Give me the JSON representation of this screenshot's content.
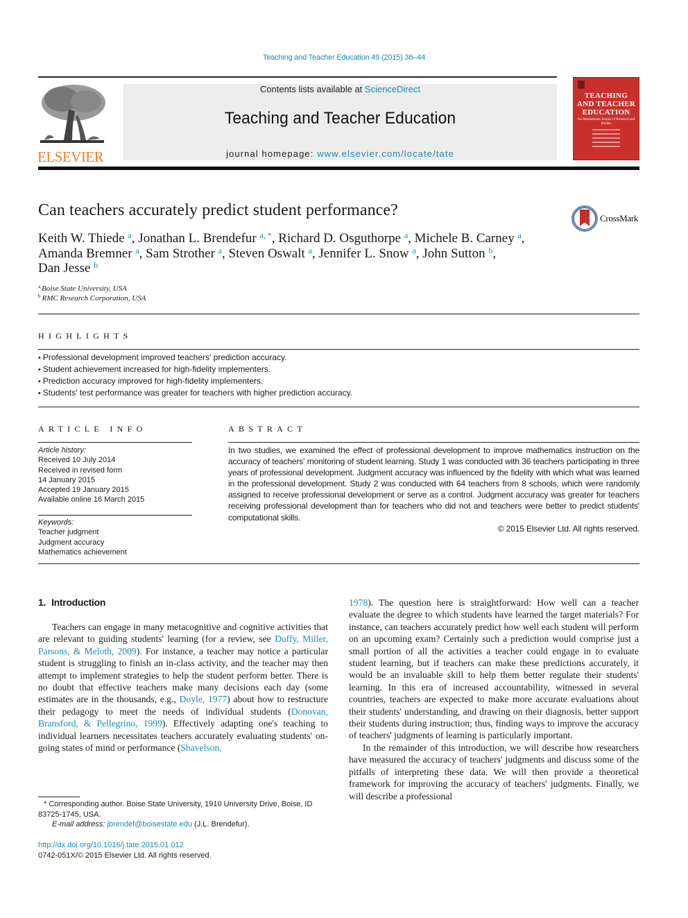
{
  "header": {
    "citation": "Teaching and Teacher Education 49 (2015) 36–44",
    "contents_prefix": "Contents lists available at ",
    "contents_link": "ScienceDirect",
    "journal_title": "Teaching and Teacher Education",
    "homepage_prefix": "journal homepage: ",
    "homepage_link": "www.elsevier.com/locate/tate",
    "publisher_logo_text": "ELSEVIER",
    "cover": {
      "line1": "TEACHING",
      "line2": "AND TEACHER",
      "line3": "EDUCATION",
      "subtitle": "An International Journal of Research and Studies",
      "color": "#c9302c"
    }
  },
  "article": {
    "title": "Can teachers accurately predict student performance?",
    "crossmark_label": "CrossMark",
    "authors": [
      {
        "name": "Keith W. Thiede",
        "aff": "a"
      },
      {
        "name": "Jonathan L. Brendefur",
        "aff": "a, *"
      },
      {
        "name": "Richard D. Osguthorpe",
        "aff": "a"
      },
      {
        "name": "Michele B. Carney",
        "aff": "a"
      },
      {
        "name": "Amanda Bremner",
        "aff": "a"
      },
      {
        "name": "Sam Strother",
        "aff": "a"
      },
      {
        "name": "Steven Oswalt",
        "aff": "a"
      },
      {
        "name": "Jennifer L. Snow",
        "aff": "a"
      },
      {
        "name": "John Sutton",
        "aff": "b"
      },
      {
        "name": "Dan Jesse",
        "aff": "b"
      }
    ],
    "affiliations": [
      {
        "key": "a",
        "text": "Boise State University, USA"
      },
      {
        "key": "b",
        "text": "RMC Research Corporation, USA"
      }
    ]
  },
  "highlights": {
    "heading": "HIGHLIGHTS",
    "items": [
      "Professional development improved teachers' prediction accuracy.",
      "Student achievement increased for high-fidelity implementers.",
      "Prediction accuracy improved for high-fidelity implementers.",
      "Students' test performance was greater for teachers with higher prediction accuracy."
    ]
  },
  "article_info": {
    "heading": "ARTICLE INFO",
    "history_label": "Article history:",
    "history": [
      "Received 10 July 2014",
      "Received in revised form",
      "14 January 2015",
      "Accepted 19 January 2015",
      "Available online 16 March 2015"
    ],
    "keywords_label": "Keywords:",
    "keywords": [
      "Teacher judgment",
      "Judgment accuracy",
      "Mathematics achievement"
    ]
  },
  "abstract": {
    "heading": "ABSTRACT",
    "text": "In two studies, we examined the effect of professional development to improve mathematics instruction on the accuracy of teachers' monitoring of student learning. Study 1 was conducted with 36 teachers participating in three years of professional development. Judgment accuracy was influenced by the fidelity with which what was learned in the professional development. Study 2 was conducted with 64 teachers from 8 schools, which were randomly assigned to receive professional development or serve as a control. Judgment accuracy was greater for teachers receiving professional development than for teachers who did not and teachers were better to predict students' computational skills.",
    "copyright": "© 2015 Elsevier Ltd. All rights reserved."
  },
  "intro": {
    "number": "1.",
    "heading": "Introduction",
    "p1_a": "Teachers can engage in many metacognitive and cognitive activities that are relevant to guiding students' learning (for a review, see ",
    "p1_ref1": "Duffy, Miller, Parsons, & Meloth, 2009",
    "p1_b": "). For instance, a teacher may notice a particular student is struggling to finish an in-class activity, and the teacher may then attempt to implement strategies to help the student perform better. There is no doubt that effective teachers make many decisions each day (some estimates are in the thousands, e.g., ",
    "p1_ref2": "Doyle, 1977",
    "p1_c": ") about how to restructure their pedagogy to meet the needs of individual students (",
    "p1_ref3": "Donovan, Bransford, & Pellegrino, 1999",
    "p1_d": "). Effectively adapting one's teaching to individual learners necessitates teachers accurately evaluating students' on-going states of mind or performance (",
    "p1_ref4a": "Shavelson,",
    "p1_ref4b": "1978",
    "p1_e": "). The question here is straightforward: How well can a teacher evaluate the degree to which students have learned the target materials? For instance, can teachers accurately predict how well each student will perform on an upcoming exam? Certainly such a prediction would comprise just a small portion of all the activities a teacher could engage in to evaluate student learning, but if teachers can make these predictions accurately, it would be an invaluable skill to help them better regulate their students' learning. In this era of increased accountability, witnessed in several countries, teachers are expected to make more accurate evaluations about their students' understanding, and drawing on their diagnosis, better support their students during instruction; thus, finding ways to improve the accuracy of teachers' judgments of learning is particularly important.",
    "p2": "In the remainder of this introduction, we will describe how researchers have measured the accuracy of teachers' judgments and discuss some of the pitfalls of interpreting these data. We will then provide a theoretical framework for improving the accuracy of teachers' judgments. Finally, we will describe a professional"
  },
  "footnote": {
    "marker": "*",
    "text": "Corresponding author. Boise State University, 1910 University Drive, Boise, ID 83725-1745, USA.",
    "email_label": "E-mail address:",
    "email": "jbrendef@boisestate.edu",
    "email_suffix": "(J.L. Brendefur)."
  },
  "doi": {
    "link": "http://dx.doi.org/10.1016/j.tate.2015.01.012",
    "rights": "0742-051X/© 2015 Elsevier Ltd. All rights reserved."
  }
}
